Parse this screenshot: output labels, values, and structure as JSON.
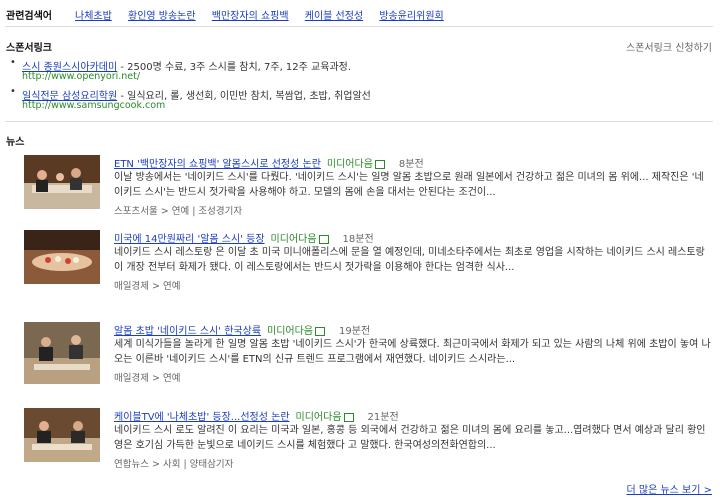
{
  "related": {
    "label": "관련검색어",
    "items": [
      "나체초밥",
      "황인영 방송논란",
      "백만장자의 쇼핑백",
      "케이블 선정성",
      "방송윤리위원회"
    ]
  },
  "sponsor": {
    "title": "스폰서링크",
    "apply": "스폰서링크 신청하기",
    "items": [
      {
        "title": "스시 종원스시아카데미",
        "desc": " - 2500명 수료, 3주 스시를 참치, 7주, 12주 교육과정.",
        "url": "http://www.openyori.net/"
      },
      {
        "title": "일식전문 삼성요리학원",
        "desc": " - 일식요리, 롤, 생선회, 이민반 참치, 복쌈업, 초밥, 취업알선",
        "url": "http://www.samsungcook.com"
      }
    ]
  },
  "news": {
    "title": "뉴스",
    "items": [
      {
        "headline": "ETN '백만장자의 쇼핑백' 알몸스시로 선정성 논란",
        "source": "미디어다음",
        "time": "8분전",
        "body": "이날 방송에서는 '네이키드 스시'를 다뤘다. '네이키드 스시'는 일명 알몸 초밥으로 원래 일본에서 건강하고 젊은 미녀의 몸 위에... 제작진은 '네이키드 스시'는 반드시 젓가락을 사용해야 하고. 모델의 몸에 손을 대서는 안된다는 조건이...",
        "meta": "스포츠서울 > 연예 | 조성경기자"
      },
      {
        "headline": "미국에 14만원짜리 '알몸 스시' 등장",
        "source": "미디어다음",
        "time": "18분전",
        "body": "네이키드 스시 레스토랑 은 이달 초 미국 미니애폴리스에 문을 열 예정인데, 미네소타주에서는 최초로 영업을 시작하는 네이키드 스시 레스토랑이 개장 전부터 화제가 됐다. 이 레스토랑에서는 반드시 젓가락을 이용해야 한다는 엄격한 식사...",
        "meta": "매일경제 > 연예"
      },
      {
        "headline": "알몸 초밥 '네이키드 스시' 한국상륙",
        "source": "미디어다음",
        "time": "19분전",
        "body": "세계 미식가들을 놀라게 한 일명 알몸 초밥 '네이키드 스시'가 한국에 상륙했다. 최근미국에서 화제가 되고 있는 사람의 나체 위에 초밥이 놓여 나오는 이른바 '네이키드 스시'를 ETN의 신규 트렌드 프로그램에서 재연했다. 네이키드 스시라는...",
        "meta": "매일경제 > 연예"
      },
      {
        "headline": "케이블TV에 '나체초밥' 등장...선정성 논란",
        "source": "미디어다음",
        "time": "21분전",
        "body": "네이키드 스시 로도 알려진 이 요리는 미국과 일본, 홍콩 등 외국에서 건강하고 젊은 미녀의 몸에 요리를 놓고...엽려했다 면서 예상과 달리 황인영은 호기심 가득한 눈빛으로 네이키드 스시를 체험했다 고 말했다. 한국여성의전화연합의...",
        "meta": "연합뉴스 > 사회 | 양태삼기자"
      }
    ],
    "more": "더 많은 뉴스 보기 >"
  }
}
